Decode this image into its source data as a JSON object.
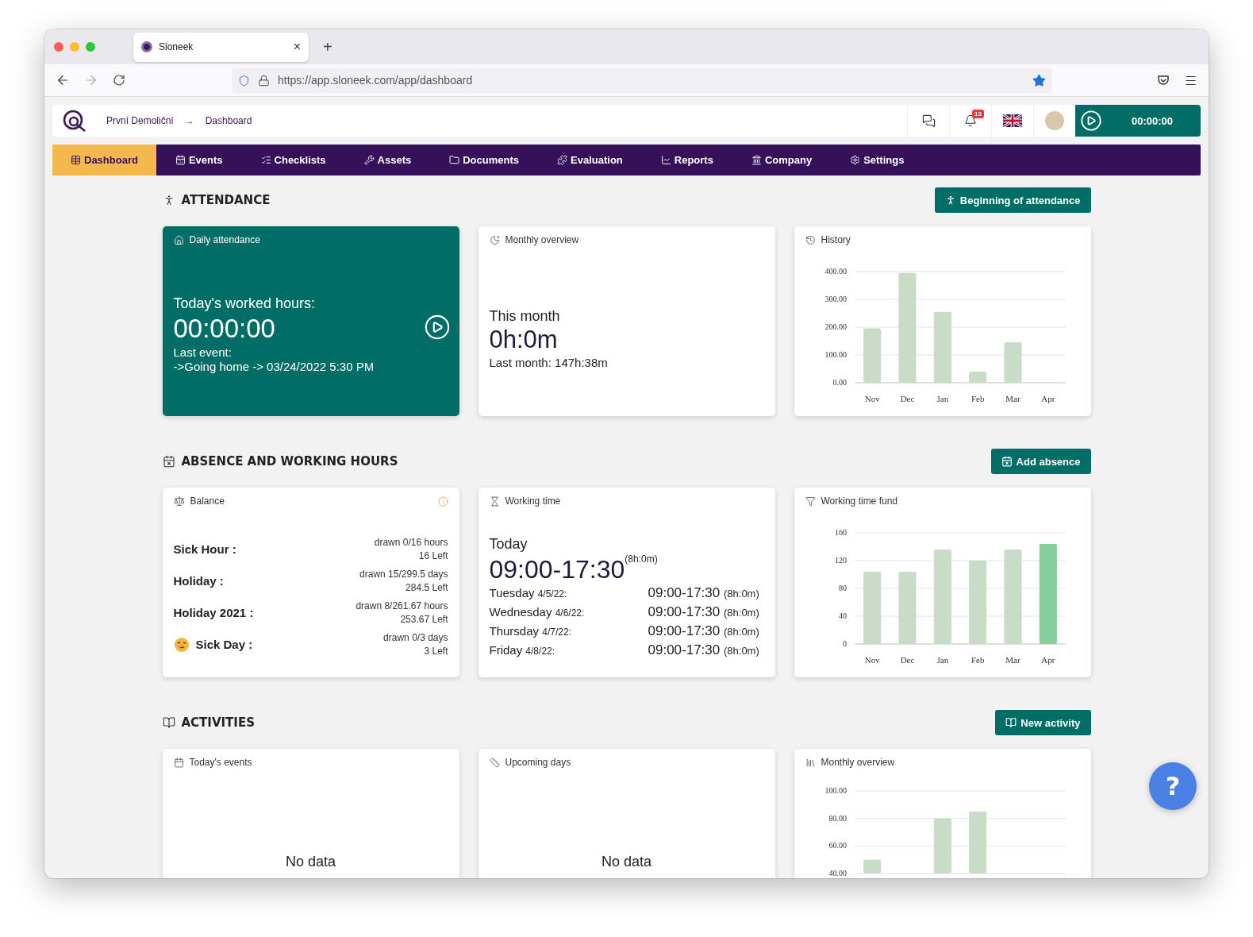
{
  "browser": {
    "tab_title": "Sloneek",
    "tab_close": "×",
    "new_tab": "+",
    "url": "https://app.sloneek.com/app/dashboard"
  },
  "header": {
    "breadcrumb": [
      "První Demoliční",
      "Dashboard"
    ],
    "breadcrumb_separator": "→",
    "notification_count": "13",
    "timer": "00:00:00"
  },
  "nav": [
    {
      "label": "Dashboard",
      "selected": true
    },
    {
      "label": "Events",
      "selected": false
    },
    {
      "label": "Checklists",
      "selected": false
    },
    {
      "label": "Assets",
      "selected": false
    },
    {
      "label": "Documents",
      "selected": false
    },
    {
      "label": "Evaluation",
      "selected": false
    },
    {
      "label": "Reports",
      "selected": false
    },
    {
      "label": "Company",
      "selected": false
    },
    {
      "label": "Settings",
      "selected": false
    }
  ],
  "attendance": {
    "title": "ATTENDANCE",
    "button": "Beginning of attendance",
    "daily": {
      "title": "Daily attendance",
      "label": "Today's worked hours:",
      "time": "00:00:00",
      "last_event_label": "Last event:",
      "last_event": "->Going home -> 03/24/2022 5:30 PM"
    },
    "monthly": {
      "title": "Monthly overview",
      "label": "This month",
      "value": "0h:0m",
      "last_month": "Last month: 147h:38m"
    },
    "history": {
      "title": "History",
      "chart_data": {
        "type": "bar",
        "categories": [
          "Nov",
          "Dec",
          "Jan",
          "Feb",
          "Mar",
          "Apr"
        ],
        "grid": true,
        "series": [
          {
            "color": "#c8dcc8",
            "values": [
              196,
              395,
              255,
              40,
              146,
              0
            ]
          }
        ],
        "ylim": [
          0,
          400
        ],
        "yticks": [
          {
            "value": 0,
            "label": "0.00"
          },
          {
            "value": 100,
            "label": "100.00"
          },
          {
            "value": 200,
            "label": "200.00"
          },
          {
            "value": 300,
            "label": "300.00"
          },
          {
            "value": 400,
            "label": "400.00"
          }
        ]
      }
    }
  },
  "absence": {
    "title": "ABSENCE AND WORKING HOURS",
    "button": "Add absence",
    "balance": {
      "title": "Balance",
      "items": [
        {
          "name": "Sick Hour :",
          "drawn": "drawn 0/16 hours",
          "left": "16 Left",
          "has_icon": false
        },
        {
          "name": "Holiday :",
          "drawn": "drawn 15/299.5 days",
          "left": "284.5 Left",
          "has_icon": false
        },
        {
          "name": "Holiday 2021 :",
          "drawn": "drawn 8/261.67 hours",
          "left": "253.67 Left",
          "has_icon": false
        },
        {
          "name": "Sick Day :",
          "drawn": "drawn 0/3 days",
          "left": "3 Left",
          "has_icon": true
        }
      ]
    },
    "working_time": {
      "title": "Working time",
      "today_label": "Today",
      "today_range": "09:00-17:30",
      "today_duration": "(8h:0m)",
      "days": [
        {
          "day": "Tuesday",
          "date": "4/5/22:",
          "range": "09:00-17:30",
          "duration": "(8h:0m)"
        },
        {
          "day": "Wednesday",
          "date": "4/6/22:",
          "range": "09:00-17:30",
          "duration": "(8h:0m)"
        },
        {
          "day": "Thursday",
          "date": "4/7/22:",
          "range": "09:00-17:30",
          "duration": "(8h:0m)"
        },
        {
          "day": "Friday",
          "date": "4/8/22:",
          "range": "09:00-17:30",
          "duration": "(8h:0m)"
        }
      ]
    },
    "fund": {
      "title": "Working time fund",
      "chart_data": {
        "type": "bar",
        "stacked": true,
        "categories": [
          "Nov",
          "Dec",
          "Jan",
          "Feb",
          "Mar",
          "Apr"
        ],
        "grid": true,
        "series": [
          {
            "color": "#c8dcc8",
            "values": [
              104,
              104,
              136,
              120,
              136,
              null
            ]
          },
          {
            "color": "#86cf9a",
            "values": [
              null,
              null,
              null,
              null,
              null,
              144
            ]
          }
        ],
        "ylim": [
          0,
          160
        ],
        "yticks": [
          0,
          40,
          80,
          120,
          160
        ]
      }
    }
  },
  "activities": {
    "title": "ACTIVITIES",
    "button": "New activity",
    "today": {
      "title": "Today's events",
      "empty": "No data"
    },
    "upcoming": {
      "title": "Upcoming days",
      "empty": "No data"
    },
    "monthly": {
      "title": "Monthly overview",
      "chart_data": {
        "type": "bar",
        "grid": true,
        "series": [
          {
            "color": "#c8dcc8",
            "values": [
              50,
              null,
              80,
              85,
              null,
              null
            ]
          }
        ],
        "ylim": [
          40,
          100
        ],
        "yticks": [
          {
            "value": 40,
            "label": "40.00"
          },
          {
            "value": 60,
            "label": "60.00"
          },
          {
            "value": 80,
            "label": "80.00"
          },
          {
            "value": 100,
            "label": "100.00"
          }
        ]
      }
    }
  },
  "help_button": "?"
}
